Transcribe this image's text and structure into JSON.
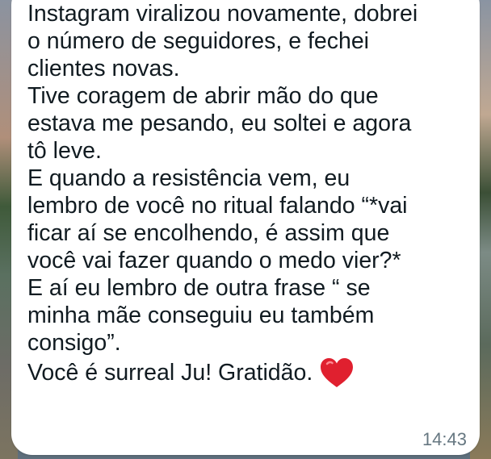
{
  "message": {
    "lines": [
      "Instagram viralizou novamente, dobrei",
      "o número de seguidores, e fechei",
      "clientes novas.",
      "Tive coragem de abrir mão do que",
      "estava me pesando, eu soltei e agora",
      "tô leve.",
      "E quando a resistência vem, eu",
      "lembro de você no ritual falando “*vai",
      "ficar aí se encolhendo, é assim que",
      "você vai fazer quando o medo vier?*",
      "E aí eu lembro de outra frase “ se",
      "minha mãe conseguiu eu também",
      "consigo”.",
      "Você é surreal Ju! Gratidão."
    ],
    "emoji": "red-heart-icon",
    "time": "14:43"
  },
  "colors": {
    "bubble": "#ffffff",
    "text": "#111b21",
    "timestamp": "#667781",
    "heart": "#e0202f"
  }
}
